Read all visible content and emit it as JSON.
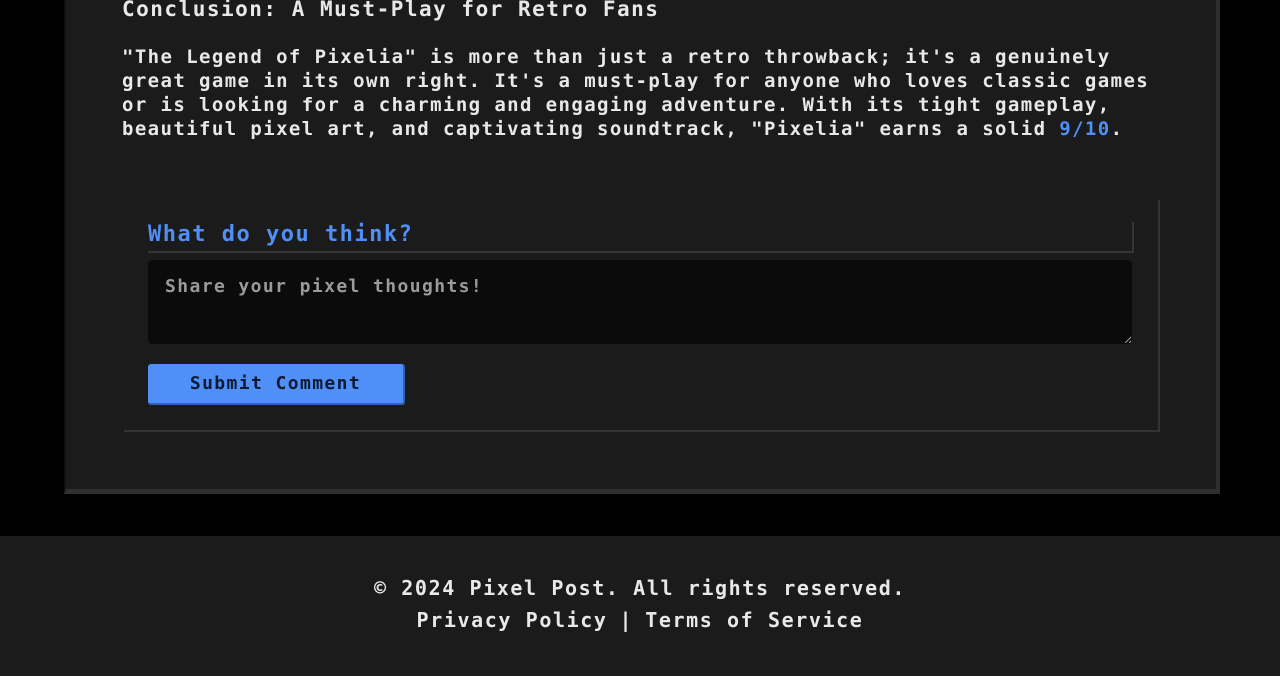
{
  "article": {
    "section_heading": "Conclusion: A Must-Play for Retro Fans",
    "paragraph_text": "\"The Legend of Pixelia\" is more than just a retro throwback; it's a genuinely great game in its own right. It's a must-play for anyone who loves classic games or is looking for a charming and engaging adventure. With its tight gameplay, beautiful pixel art, and captivating soundtrack, \"Pixelia\" earns a solid ",
    "rating": "9/10",
    "paragraph_end": "."
  },
  "comments": {
    "heading": "What do you think?",
    "placeholder": "Share your pixel thoughts!",
    "value": "",
    "submit_label": "Submit Comment"
  },
  "footer": {
    "copyright": "© 2024 Pixel Post. All rights reserved.",
    "privacy_link": "Privacy Policy",
    "separator": "|",
    "terms_link": "Terms of Service"
  },
  "colors": {
    "accent": "#4f8ff7",
    "background": "#000000",
    "card": "#1b1b1b",
    "text": "#e8e8e8"
  }
}
